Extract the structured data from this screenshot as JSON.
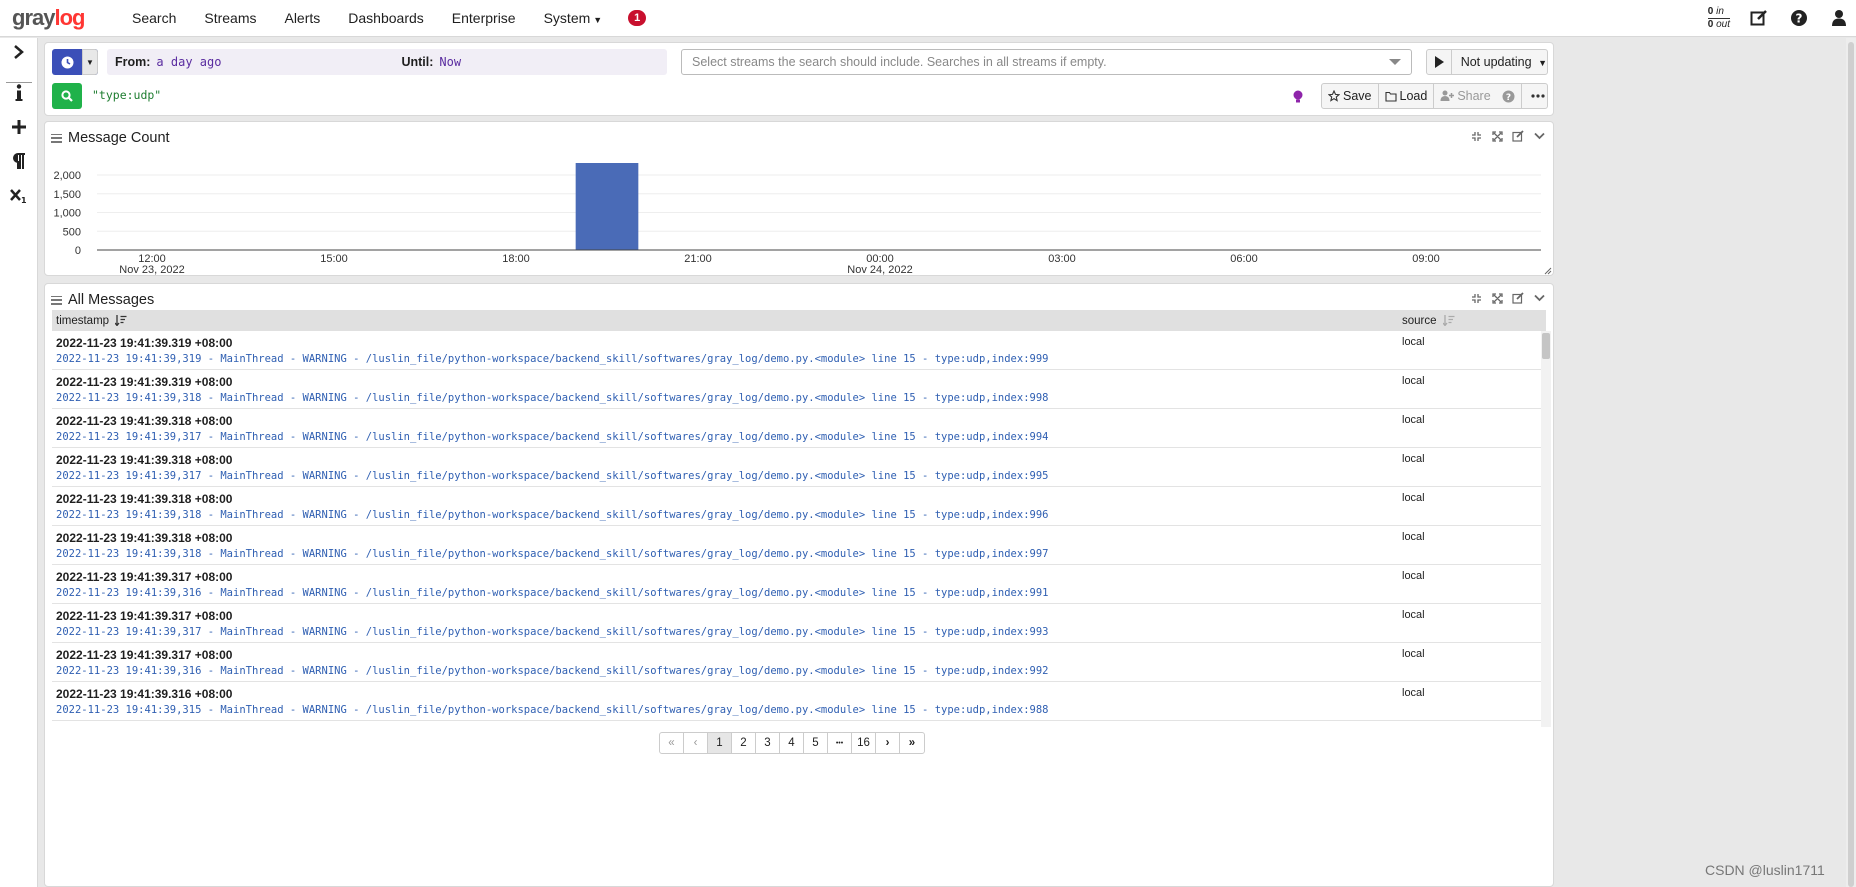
{
  "brand": {
    "gray": "gray",
    "log": "log"
  },
  "nav": {
    "items": [
      "Search",
      "Streams",
      "Alerts",
      "Dashboards",
      "Enterprise",
      "System"
    ],
    "notifications": "1",
    "throughput_in": "0",
    "in_label": "in",
    "throughput_out": "0",
    "out_label": "out"
  },
  "search": {
    "from_label": "From:",
    "from_value": "a day ago",
    "until_label": "Until:",
    "until_value": "Now",
    "streams_placeholder": "Select streams the search should include. Searches in all streams if empty.",
    "refresh_label": "Not updating",
    "query": "\"type:udp\"",
    "save": "Save",
    "load": "Load",
    "share": "Share"
  },
  "message_count": {
    "title": "Message Count"
  },
  "chart_data": {
    "type": "bar",
    "x_ticks": [
      "12:00",
      "15:00",
      "18:00",
      "21:00",
      "00:00",
      "03:00",
      "06:00",
      "09:00"
    ],
    "x_date_labels": [
      {
        "at": "12:00",
        "label": "Nov 23, 2022"
      },
      {
        "at": "00:00",
        "label": "Nov 24, 2022"
      }
    ],
    "y_ticks": [
      0,
      500,
      1000,
      1500,
      2000
    ],
    "y_tick_labels": [
      "0",
      "500",
      "1,000",
      "1,500",
      "2,000"
    ],
    "ylim": [
      0,
      2400
    ],
    "bars": [
      {
        "start": "19:00",
        "end": "20:00",
        "value": 2320
      }
    ],
    "color": "#4a6bb7",
    "grid": true
  },
  "all_messages": {
    "title": "All Messages",
    "col_timestamp": "timestamp",
    "col_source": "source",
    "rows": [
      {
        "ts": "2022-11-23 19:41:39.319 +08:00",
        "msg": "2022-11-23 19:41:39,319 - MainThread - WARNING - /luslin_file/python-workspace/backend_skill/softwares/gray_log/demo.py.<module> line 15 - type:udp,index:999",
        "src": "local"
      },
      {
        "ts": "2022-11-23 19:41:39.319 +08:00",
        "msg": "2022-11-23 19:41:39,318 - MainThread - WARNING - /luslin_file/python-workspace/backend_skill/softwares/gray_log/demo.py.<module> line 15 - type:udp,index:998",
        "src": "local"
      },
      {
        "ts": "2022-11-23 19:41:39.318 +08:00",
        "msg": "2022-11-23 19:41:39,317 - MainThread - WARNING - /luslin_file/python-workspace/backend_skill/softwares/gray_log/demo.py.<module> line 15 - type:udp,index:994",
        "src": "local"
      },
      {
        "ts": "2022-11-23 19:41:39.318 +08:00",
        "msg": "2022-11-23 19:41:39,317 - MainThread - WARNING - /luslin_file/python-workspace/backend_skill/softwares/gray_log/demo.py.<module> line 15 - type:udp,index:995",
        "src": "local"
      },
      {
        "ts": "2022-11-23 19:41:39.318 +08:00",
        "msg": "2022-11-23 19:41:39,318 - MainThread - WARNING - /luslin_file/python-workspace/backend_skill/softwares/gray_log/demo.py.<module> line 15 - type:udp,index:996",
        "src": "local"
      },
      {
        "ts": "2022-11-23 19:41:39.318 +08:00",
        "msg": "2022-11-23 19:41:39,318 - MainThread - WARNING - /luslin_file/python-workspace/backend_skill/softwares/gray_log/demo.py.<module> line 15 - type:udp,index:997",
        "src": "local"
      },
      {
        "ts": "2022-11-23 19:41:39.317 +08:00",
        "msg": "2022-11-23 19:41:39,316 - MainThread - WARNING - /luslin_file/python-workspace/backend_skill/softwares/gray_log/demo.py.<module> line 15 - type:udp,index:991",
        "src": "local"
      },
      {
        "ts": "2022-11-23 19:41:39.317 +08:00",
        "msg": "2022-11-23 19:41:39,317 - MainThread - WARNING - /luslin_file/python-workspace/backend_skill/softwares/gray_log/demo.py.<module> line 15 - type:udp,index:993",
        "src": "local"
      },
      {
        "ts": "2022-11-23 19:41:39.317 +08:00",
        "msg": "2022-11-23 19:41:39,316 - MainThread - WARNING - /luslin_file/python-workspace/backend_skill/softwares/gray_log/demo.py.<module> line 15 - type:udp,index:992",
        "src": "local"
      },
      {
        "ts": "2022-11-23 19:41:39.316 +08:00",
        "msg": "2022-11-23 19:41:39,315 - MainThread - WARNING - /luslin_file/python-workspace/backend_skill/softwares/gray_log/demo.py.<module> line 15 - type:udp,index:988",
        "src": "local"
      }
    ]
  },
  "pagination": {
    "first": "«",
    "prev": "‹",
    "pages": [
      "1",
      "2",
      "3",
      "4",
      "5"
    ],
    "ellipsis": "•••",
    "last_page": "16",
    "next": "›",
    "last": "»",
    "current": "1"
  },
  "watermark": "CSDN @luslin1711",
  "colors": {
    "primary": "#3b4fb8",
    "success": "#20b24a",
    "danger": "#c8102e",
    "brand_red": "#ff3633",
    "query_green": "#1e7d30",
    "message_blue": "#2f5fb2"
  }
}
